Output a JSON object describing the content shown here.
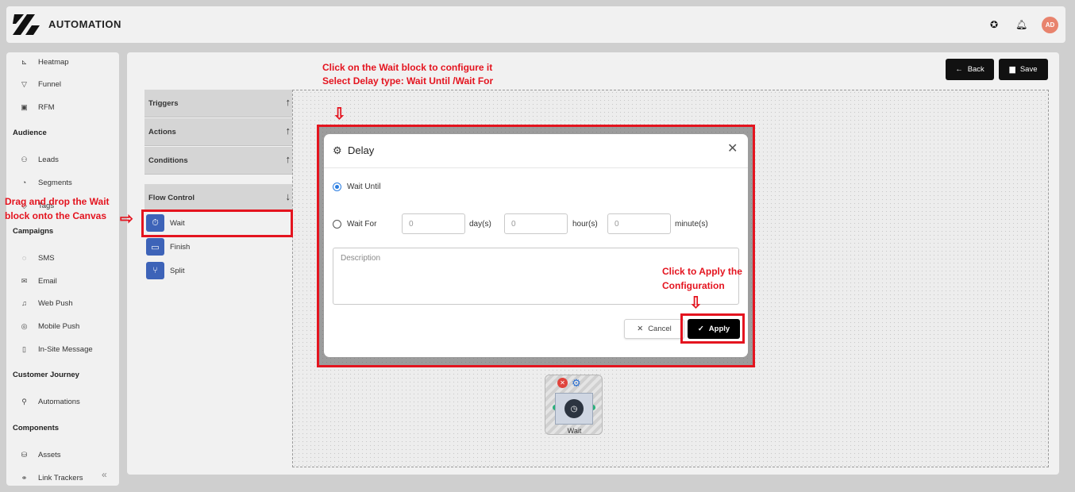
{
  "app": {
    "title": "AUTOMATION",
    "avatar_initials": "AD",
    "icons": [
      "logo-icon",
      "support-icon",
      "bell-icon"
    ]
  },
  "sidebar": {
    "groups": [
      {
        "items": [
          {
            "label": "Heatmap",
            "icon": "heatmap-icon"
          },
          {
            "label": "Funnel",
            "icon": "funnel-icon"
          },
          {
            "label": "RFM",
            "icon": "rfm-icon"
          }
        ]
      },
      {
        "heading": "Audience",
        "items": [
          {
            "label": "Leads",
            "icon": "leads-icon"
          },
          {
            "label": "Segments",
            "icon": "segments-icon"
          },
          {
            "label": "Tags",
            "icon": "tag-icon"
          }
        ]
      },
      {
        "heading": "Campaigns",
        "items": [
          {
            "label": "SMS",
            "icon": "sms-icon"
          },
          {
            "label": "Email",
            "icon": "email-icon"
          },
          {
            "label": "Web Push",
            "icon": "bell-icon"
          },
          {
            "label": "Mobile Push",
            "icon": "mobile-icon"
          },
          {
            "label": "In-Site Message",
            "icon": "message-icon"
          }
        ]
      },
      {
        "heading": "Customer Journey",
        "items": [
          {
            "label": "Automations",
            "icon": "automation-icon"
          }
        ]
      },
      {
        "heading": "Components",
        "items": [
          {
            "label": "Assets",
            "icon": "database-icon"
          },
          {
            "label": "Link Trackers",
            "icon": "link-icon"
          }
        ]
      }
    ]
  },
  "toolbar": {
    "back_label": "Back",
    "save_label": "Save"
  },
  "palette": {
    "groups": [
      {
        "label": "Triggers"
      },
      {
        "label": "Actions"
      },
      {
        "label": "Conditions"
      },
      {
        "label": "Flow Control"
      }
    ],
    "blocks": [
      {
        "label": "Wait"
      },
      {
        "label": "Finish"
      },
      {
        "label": "Split"
      }
    ]
  },
  "dialog": {
    "title": "Delay",
    "wait_until_label": "Wait Until",
    "wait_for_label": "Wait For",
    "selected": "wait_until",
    "days_placeholder": "0",
    "hours_placeholder": "0",
    "minutes_placeholder": "0",
    "days_unit": "day(s)",
    "hours_unit": "hour(s)",
    "minutes_unit": "minute(s)",
    "description_placeholder": "Description",
    "cancel_label": "Cancel",
    "apply_label": "Apply"
  },
  "canvas_node": {
    "label": "Wait"
  },
  "annotations": {
    "top_line1": "Click on the Wait block to configure it",
    "top_line2": "Select Delay type: Wait Until /Wait For",
    "drag_line1": "Drag and drop the Wait",
    "drag_line2": "block onto the Canvas",
    "apply_line1": "Click to Apply the",
    "apply_line2": "Configuration",
    "color": "#e4141f"
  }
}
